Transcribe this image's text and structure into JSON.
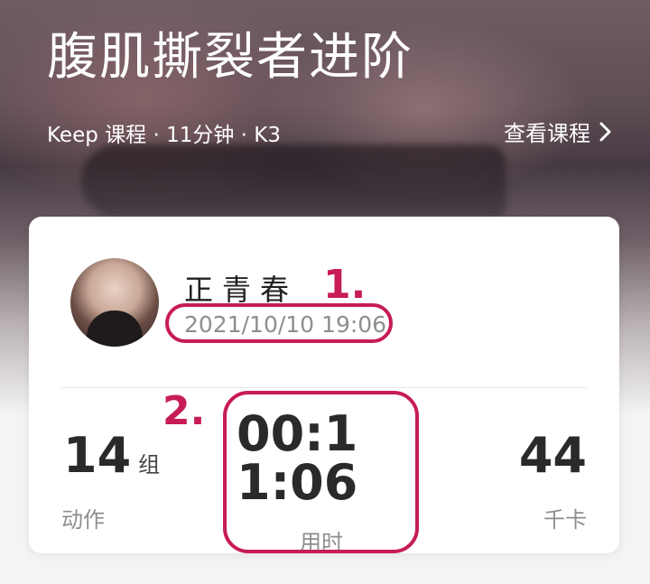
{
  "course": {
    "title": "腹肌撕裂者进阶",
    "meta": "Keep 课程 · 11分钟 · K3",
    "view_label": "查看课程"
  },
  "record": {
    "username": "正青春",
    "datetime": "2021/10/10 19:06"
  },
  "stats": {
    "actions": {
      "value": "14",
      "unit": "组",
      "label": "动作"
    },
    "duration": {
      "value": "00:11:06",
      "label": "用时"
    },
    "calories": {
      "value": "44",
      "label": "千卡"
    }
  },
  "annotations": {
    "marker1": "1.",
    "marker2": "2.",
    "color": "#c71c55"
  },
  "icons": {
    "view_course": "chevron-right-icon",
    "avatar": "user-avatar"
  }
}
